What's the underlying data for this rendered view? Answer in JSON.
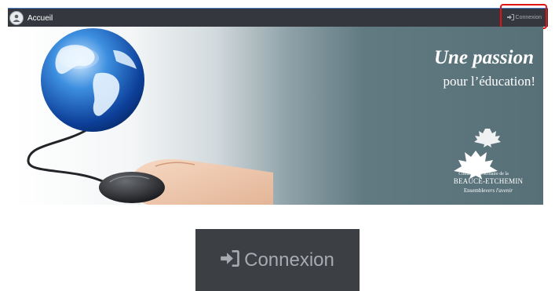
{
  "navbar": {
    "brand_label": "Accueil",
    "login_label": "Connexion",
    "brand_icon": "school-logo-icon",
    "login_icon": "sign-in-icon"
  },
  "banner": {
    "slogan_line1": "Une passion",
    "slogan_line2": "pour l’éducation!",
    "org_small": "Commission scolaire de la",
    "org_name": "BEAUCE-ETCHEMIN",
    "tagline_main": "Ensemble",
    "tagline_italic": "vers l'avenir"
  },
  "zoom": {
    "login_label": "Connexion",
    "login_icon": "sign-in-icon"
  },
  "colors": {
    "navbar_bg": "#34383e",
    "highlight": "#e01414",
    "banner_teal": "#577078",
    "login_text": "#a9adb3"
  }
}
